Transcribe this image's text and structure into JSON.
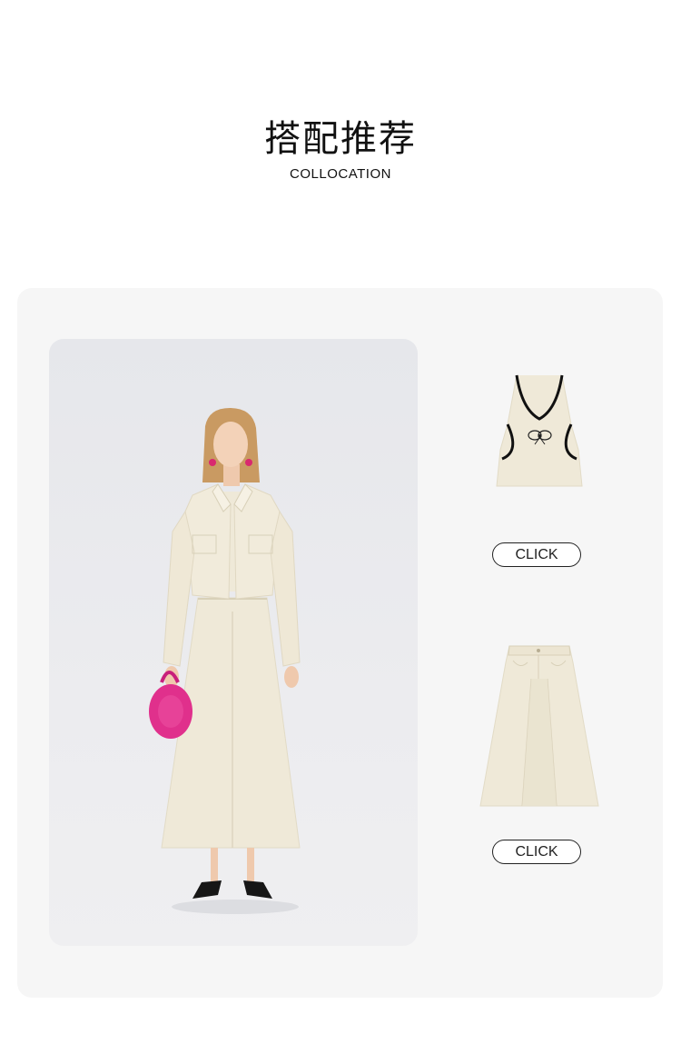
{
  "header": {
    "title": "搭配推荐",
    "subtitle": "COLLOCATION"
  },
  "products": [
    {
      "button_label": "CLICK",
      "icon": "halter-top-image"
    },
    {
      "button_label": "CLICK",
      "icon": "wide-skirt-image"
    }
  ],
  "colors": {
    "page_background": "#ffffff",
    "card_background": "#f6f6f6",
    "photo_background": "#ececef",
    "garment_cream": "#efe9d8",
    "trim_black": "#111111",
    "bag_pink": "#e0308c"
  }
}
